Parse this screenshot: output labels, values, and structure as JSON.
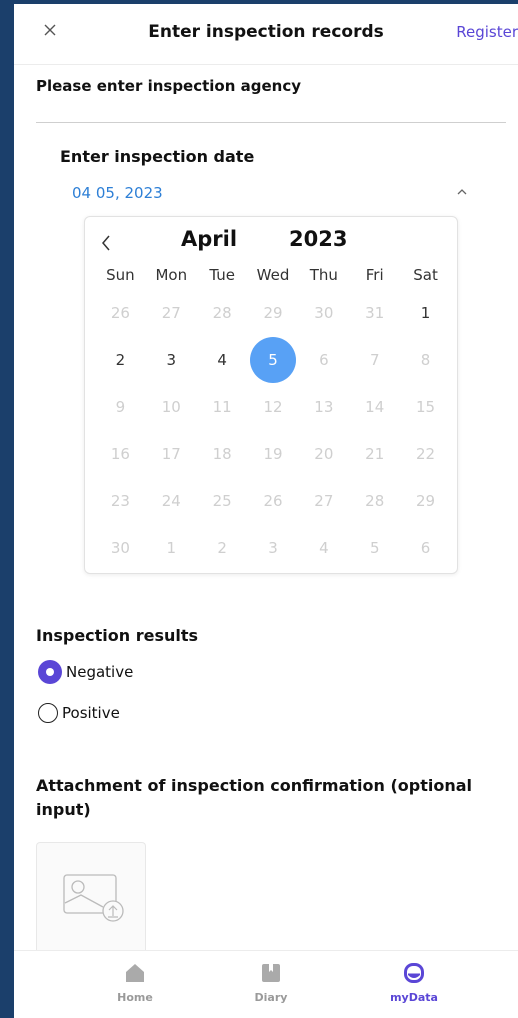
{
  "header": {
    "title": "Enter inspection records",
    "register_label": "Register"
  },
  "agency": {
    "label": "Please enter inspection agency",
    "value": ""
  },
  "date": {
    "label": "Enter inspection date",
    "value": "04 05, 2023"
  },
  "calendar": {
    "month": "April",
    "year": "2023",
    "weekdays": [
      "Sun",
      "Mon",
      "Tue",
      "Wed",
      "Thu",
      "Fri",
      "Sat"
    ],
    "days": [
      {
        "d": "26",
        "muted": true
      },
      {
        "d": "27",
        "muted": true
      },
      {
        "d": "28",
        "muted": true
      },
      {
        "d": "29",
        "muted": true
      },
      {
        "d": "30",
        "muted": true
      },
      {
        "d": "31",
        "muted": true
      },
      {
        "d": "1",
        "muted": false
      },
      {
        "d": "2",
        "muted": false
      },
      {
        "d": "3",
        "muted": false
      },
      {
        "d": "4",
        "muted": false
      },
      {
        "d": "5",
        "muted": false,
        "selected": true
      },
      {
        "d": "6",
        "muted": true
      },
      {
        "d": "7",
        "muted": true
      },
      {
        "d": "8",
        "muted": true
      },
      {
        "d": "9",
        "muted": true
      },
      {
        "d": "10",
        "muted": true
      },
      {
        "d": "11",
        "muted": true
      },
      {
        "d": "12",
        "muted": true
      },
      {
        "d": "13",
        "muted": true
      },
      {
        "d": "14",
        "muted": true
      },
      {
        "d": "15",
        "muted": true
      },
      {
        "d": "16",
        "muted": true
      },
      {
        "d": "17",
        "muted": true
      },
      {
        "d": "18",
        "muted": true
      },
      {
        "d": "19",
        "muted": true
      },
      {
        "d": "20",
        "muted": true
      },
      {
        "d": "21",
        "muted": true
      },
      {
        "d": "22",
        "muted": true
      },
      {
        "d": "23",
        "muted": true
      },
      {
        "d": "24",
        "muted": true
      },
      {
        "d": "25",
        "muted": true
      },
      {
        "d": "26",
        "muted": true
      },
      {
        "d": "27",
        "muted": true
      },
      {
        "d": "28",
        "muted": true
      },
      {
        "d": "29",
        "muted": true
      },
      {
        "d": "30",
        "muted": true
      },
      {
        "d": "1",
        "muted": true
      },
      {
        "d": "2",
        "muted": true
      },
      {
        "d": "3",
        "muted": true
      },
      {
        "d": "4",
        "muted": true
      },
      {
        "d": "5",
        "muted": true
      },
      {
        "d": "6",
        "muted": true
      }
    ]
  },
  "results": {
    "label": "Inspection results",
    "options": [
      {
        "label": "Negative",
        "selected": true
      },
      {
        "label": "Positive",
        "selected": false
      }
    ]
  },
  "attachment": {
    "label": "Attachment of inspection confirmation (optional input)"
  },
  "nav": {
    "items": [
      {
        "label": "Home",
        "icon": "home-icon"
      },
      {
        "label": "Diary",
        "icon": "diary-icon"
      },
      {
        "label": "myData",
        "icon": "mydata-icon",
        "active": true
      }
    ]
  },
  "colors": {
    "accent": "#5a46d6",
    "selected_day": "#58a1f5",
    "date_text": "#2d7fd6",
    "frame": "#1b3f6b"
  }
}
